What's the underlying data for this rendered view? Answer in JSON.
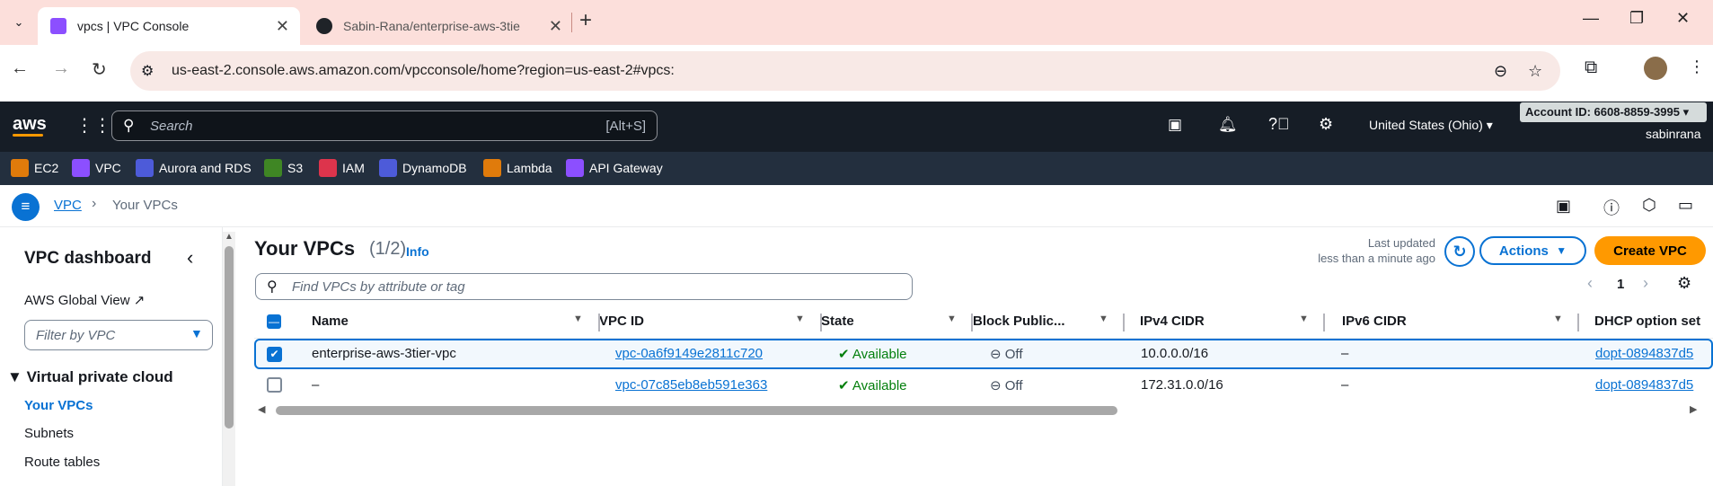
{
  "browser": {
    "tabs": [
      {
        "title": "vpcs | VPC Console",
        "active": true
      },
      {
        "title": "Sabin-Rana/enterprise-aws-3tie",
        "active": false
      }
    ],
    "url": "us-east-2.console.aws.amazon.com/vpcconsole/home?region=us-east-2#vpcs:"
  },
  "aws_header": {
    "logo": "aws",
    "search_placeholder": "Search",
    "search_shortcut": "[Alt+S]",
    "region": "United States (Ohio)",
    "account_id": "Account ID: 6608-8859-3995",
    "username": "sabinrana"
  },
  "favorites": [
    "EC2",
    "VPC",
    "Aurora and RDS",
    "S3",
    "IAM",
    "DynamoDB",
    "Lambda",
    "API Gateway"
  ],
  "breadcrumb": {
    "root": "VPC",
    "current": "Your VPCs"
  },
  "sidebar": {
    "title": "VPC dashboard",
    "global_view": "AWS Global View",
    "filter_placeholder": "Filter by VPC",
    "section": "Virtual private cloud",
    "items": [
      "Your VPCs",
      "Subnets",
      "Route tables"
    ]
  },
  "main": {
    "title": "Your VPCs",
    "count": "(1/2)",
    "info": "Info",
    "last_updated_label": "Last updated",
    "last_updated_value": "less than a minute ago",
    "actions_label": "Actions",
    "create_label": "Create VPC",
    "search_placeholder": "Find VPCs by attribute or tag",
    "page": "1",
    "columns": [
      "Name",
      "VPC ID",
      "State",
      "Block Public...",
      "IPv4 CIDR",
      "IPv6 CIDR",
      "DHCP option set"
    ],
    "rows": [
      {
        "name": "enterprise-aws-3tier-vpc",
        "vpc_id": "vpc-0a6f9149e2811c720",
        "state": "Available",
        "block": "Off",
        "ipv4": "10.0.0.0/16",
        "ipv6": "–",
        "dhcp": "dopt-0894837d5",
        "selected": true
      },
      {
        "name": "–",
        "vpc_id": "vpc-07c85eb8eb591e363",
        "state": "Available",
        "block": "Off",
        "ipv4": "172.31.0.0/16",
        "ipv6": "–",
        "dhcp": "dopt-0894837d5",
        "selected": false
      }
    ]
  },
  "colors": {
    "accent_orange": "#ff9900",
    "link_blue": "#0972d3",
    "available_green": "#037f0c",
    "header_dark": "#161d26"
  }
}
